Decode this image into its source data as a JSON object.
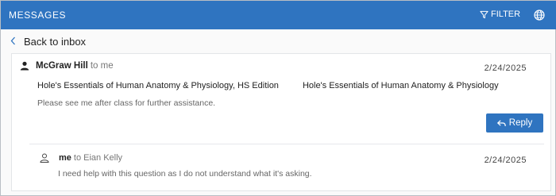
{
  "header": {
    "title": "MESSAGES",
    "filter_label": "FILTER",
    "filter_icon": "filter-icon",
    "globe_icon": "globe-icon",
    "background": "#2f74c0"
  },
  "nav": {
    "back_label": "Back to inbox",
    "back_icon": "chevron-left-icon"
  },
  "thread": {
    "messages": [
      {
        "sender": "McGraw Hill",
        "recipient_text": "to me",
        "date": "2/24/2025",
        "books": [
          "Hole's Essentials of Human Anatomy & Physiology, HS Edition",
          "Hole's Essentials of Human Anatomy & Physiology"
        ],
        "body": "Please see me after class for further assistance.",
        "avatar_icon": "person-icon"
      },
      {
        "sender": "me",
        "recipient_text": "to Eian Kelly",
        "date": "2/24/2025",
        "body": "I need help with this question as I do not understand what it's asking.",
        "avatar_icon": "person-outline-icon"
      }
    ],
    "reply_label": "Reply",
    "reply_icon": "reply-icon"
  }
}
